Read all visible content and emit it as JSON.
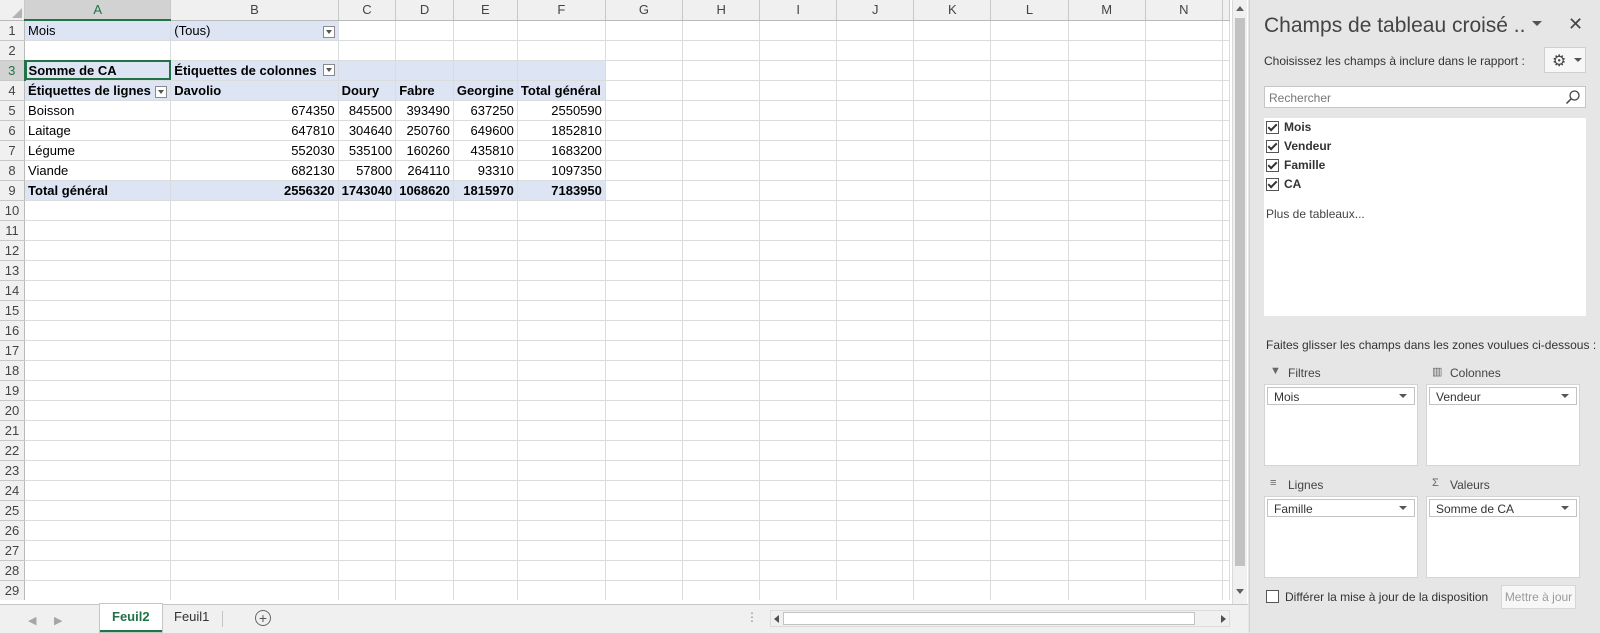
{
  "grid": {
    "columns": [
      "A",
      "B",
      "C",
      "D",
      "E",
      "F",
      "G",
      "H",
      "I",
      "J",
      "K",
      "L",
      "M",
      "N"
    ],
    "rows": [
      "1",
      "2",
      "3",
      "4",
      "5",
      "6",
      "7",
      "8",
      "9",
      "10",
      "11",
      "12",
      "13",
      "14",
      "15",
      "16",
      "17",
      "18",
      "19",
      "20",
      "21",
      "22",
      "23",
      "24",
      "25",
      "26",
      "27",
      "28",
      "29"
    ]
  },
  "pivot": {
    "filter_label": "Mois",
    "filter_value": "(Tous)",
    "value_field": "Somme de CA",
    "col_labels_header": "Étiquettes de colonnes",
    "row_labels_header": "Étiquettes de lignes",
    "col_headers": [
      "Davolio",
      "Doury",
      "Fabre",
      "Georgine",
      "Total général"
    ],
    "rows": [
      {
        "label": "Boisson",
        "values": [
          "674350",
          "845500",
          "393490",
          "637250",
          "2550590"
        ]
      },
      {
        "label": "Laitage",
        "values": [
          "647810",
          "304640",
          "250760",
          "649600",
          "1852810"
        ]
      },
      {
        "label": "Légume",
        "values": [
          "552030",
          "535100",
          "160260",
          "435810",
          "1683200"
        ]
      },
      {
        "label": "Viande",
        "values": [
          "682130",
          "57800",
          "264110",
          "93310",
          "1097350"
        ]
      }
    ],
    "total_row": {
      "label": "Total général",
      "values": [
        "2556320",
        "1743040",
        "1068620",
        "1815970",
        "7183950"
      ]
    }
  },
  "tabs": {
    "sheets": [
      "Feuil2",
      "Feuil1"
    ],
    "active": "Feuil2",
    "add_icon": "plus-circle-icon",
    "dots": "⋮"
  },
  "pane": {
    "title": "Champs de tableau croisé ..",
    "close": "✕",
    "subtitle": "Choisissez les champs à inclure dans le rapport :",
    "gear_icon": "gear-icon",
    "search_placeholder": "Rechercher",
    "fields": [
      {
        "label": "Mois",
        "checked": true
      },
      {
        "label": "Vendeur",
        "checked": true
      },
      {
        "label": "Famille",
        "checked": true
      },
      {
        "label": "CA",
        "checked": true
      }
    ],
    "more_tables": "Plus de tableaux...",
    "drag_hint": "Faites glisser les champs dans les zones voulues ci-dessous :",
    "zones": {
      "filters": {
        "label": "Filtres",
        "icon": "filter-icon",
        "item": "Mois"
      },
      "columns": {
        "label": "Colonnes",
        "icon": "columns-icon",
        "item": "Vendeur"
      },
      "rows": {
        "label": "Lignes",
        "icon": "rows-icon",
        "item": "Famille"
      },
      "values": {
        "label": "Valeurs",
        "icon": "sigma-icon",
        "item": "Somme de CA"
      }
    },
    "defer_label": "Différer la mise à jour de la disposition",
    "update_button": "Mettre à jour"
  },
  "colors": {
    "accent": "#217346",
    "pivot_fill": "#dde4f4"
  }
}
